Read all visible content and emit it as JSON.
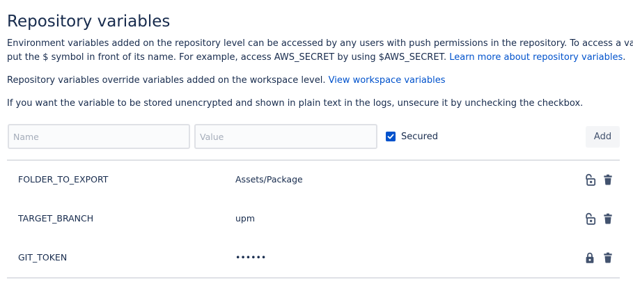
{
  "header": {
    "title": "Repository variables"
  },
  "description": {
    "line1": "Environment variables added on the repository level can be accessed by any users with push permissions in the repository. To access a variable,",
    "line2_text": "put the $ symbol in front of its name. For example, access AWS_SECRET by using $AWS_SECRET. ",
    "line2_link": "Learn more about repository variables",
    "line2_end": ".",
    "override_text": "Repository variables override variables added on the workspace level. ",
    "override_link": "View workspace variables",
    "unsecure_text": "If you want the variable to be stored unencrypted and shown in plain text in the logs, unsecure it by unchecking the checkbox."
  },
  "form": {
    "name_placeholder": "Name",
    "value_placeholder": "Value",
    "secured_label": "Secured",
    "secured_checked": true,
    "add_label": "Add"
  },
  "variables": [
    {
      "name": "FOLDER_TO_EXPORT",
      "value": "Assets/Package",
      "secured": false
    },
    {
      "name": "TARGET_BRANCH",
      "value": "upm",
      "secured": false
    },
    {
      "name": "GIT_TOKEN",
      "value": "••••••",
      "secured": true
    }
  ],
  "colors": {
    "text": "#172b4d",
    "link": "#0052cc",
    "checkbox": "#0052cc",
    "icon": "#42526e",
    "divider": "#dfe1e6"
  }
}
